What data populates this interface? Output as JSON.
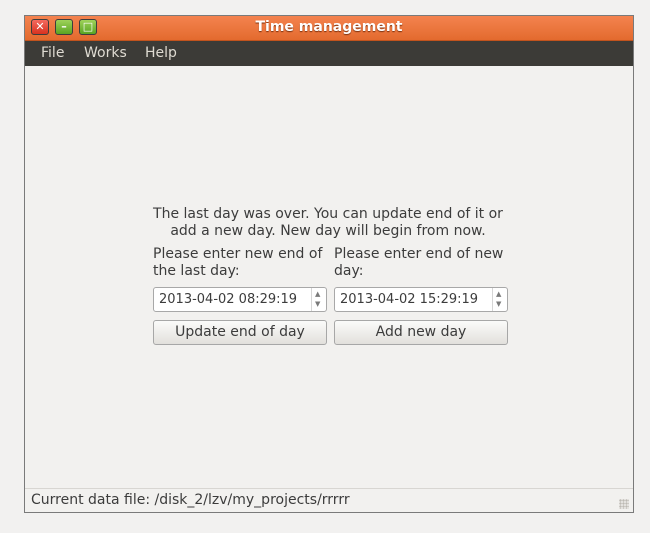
{
  "window": {
    "title": "Time management",
    "buttons": {
      "close": "✕",
      "minimize": "–",
      "maximize": "□"
    }
  },
  "menu": [
    "File",
    "Works",
    "Help"
  ],
  "message": "The last day was over. You can update end of it or add a new day. New day will begin from now.",
  "left": {
    "label": "Please enter new end of the last day:",
    "value": "2013-04-02 08:29:19",
    "button": "Update end of day"
  },
  "right": {
    "label": "Please enter end of new day:",
    "value": "2013-04-02 15:29:19",
    "button": "Add new day"
  },
  "status": "Current data file: /disk_2/lzv/my_projects/rrrrr",
  "colors": {
    "titlebar": "#e36a2e",
    "menubar": "#3c3b37",
    "background": "#f2f1f0"
  }
}
